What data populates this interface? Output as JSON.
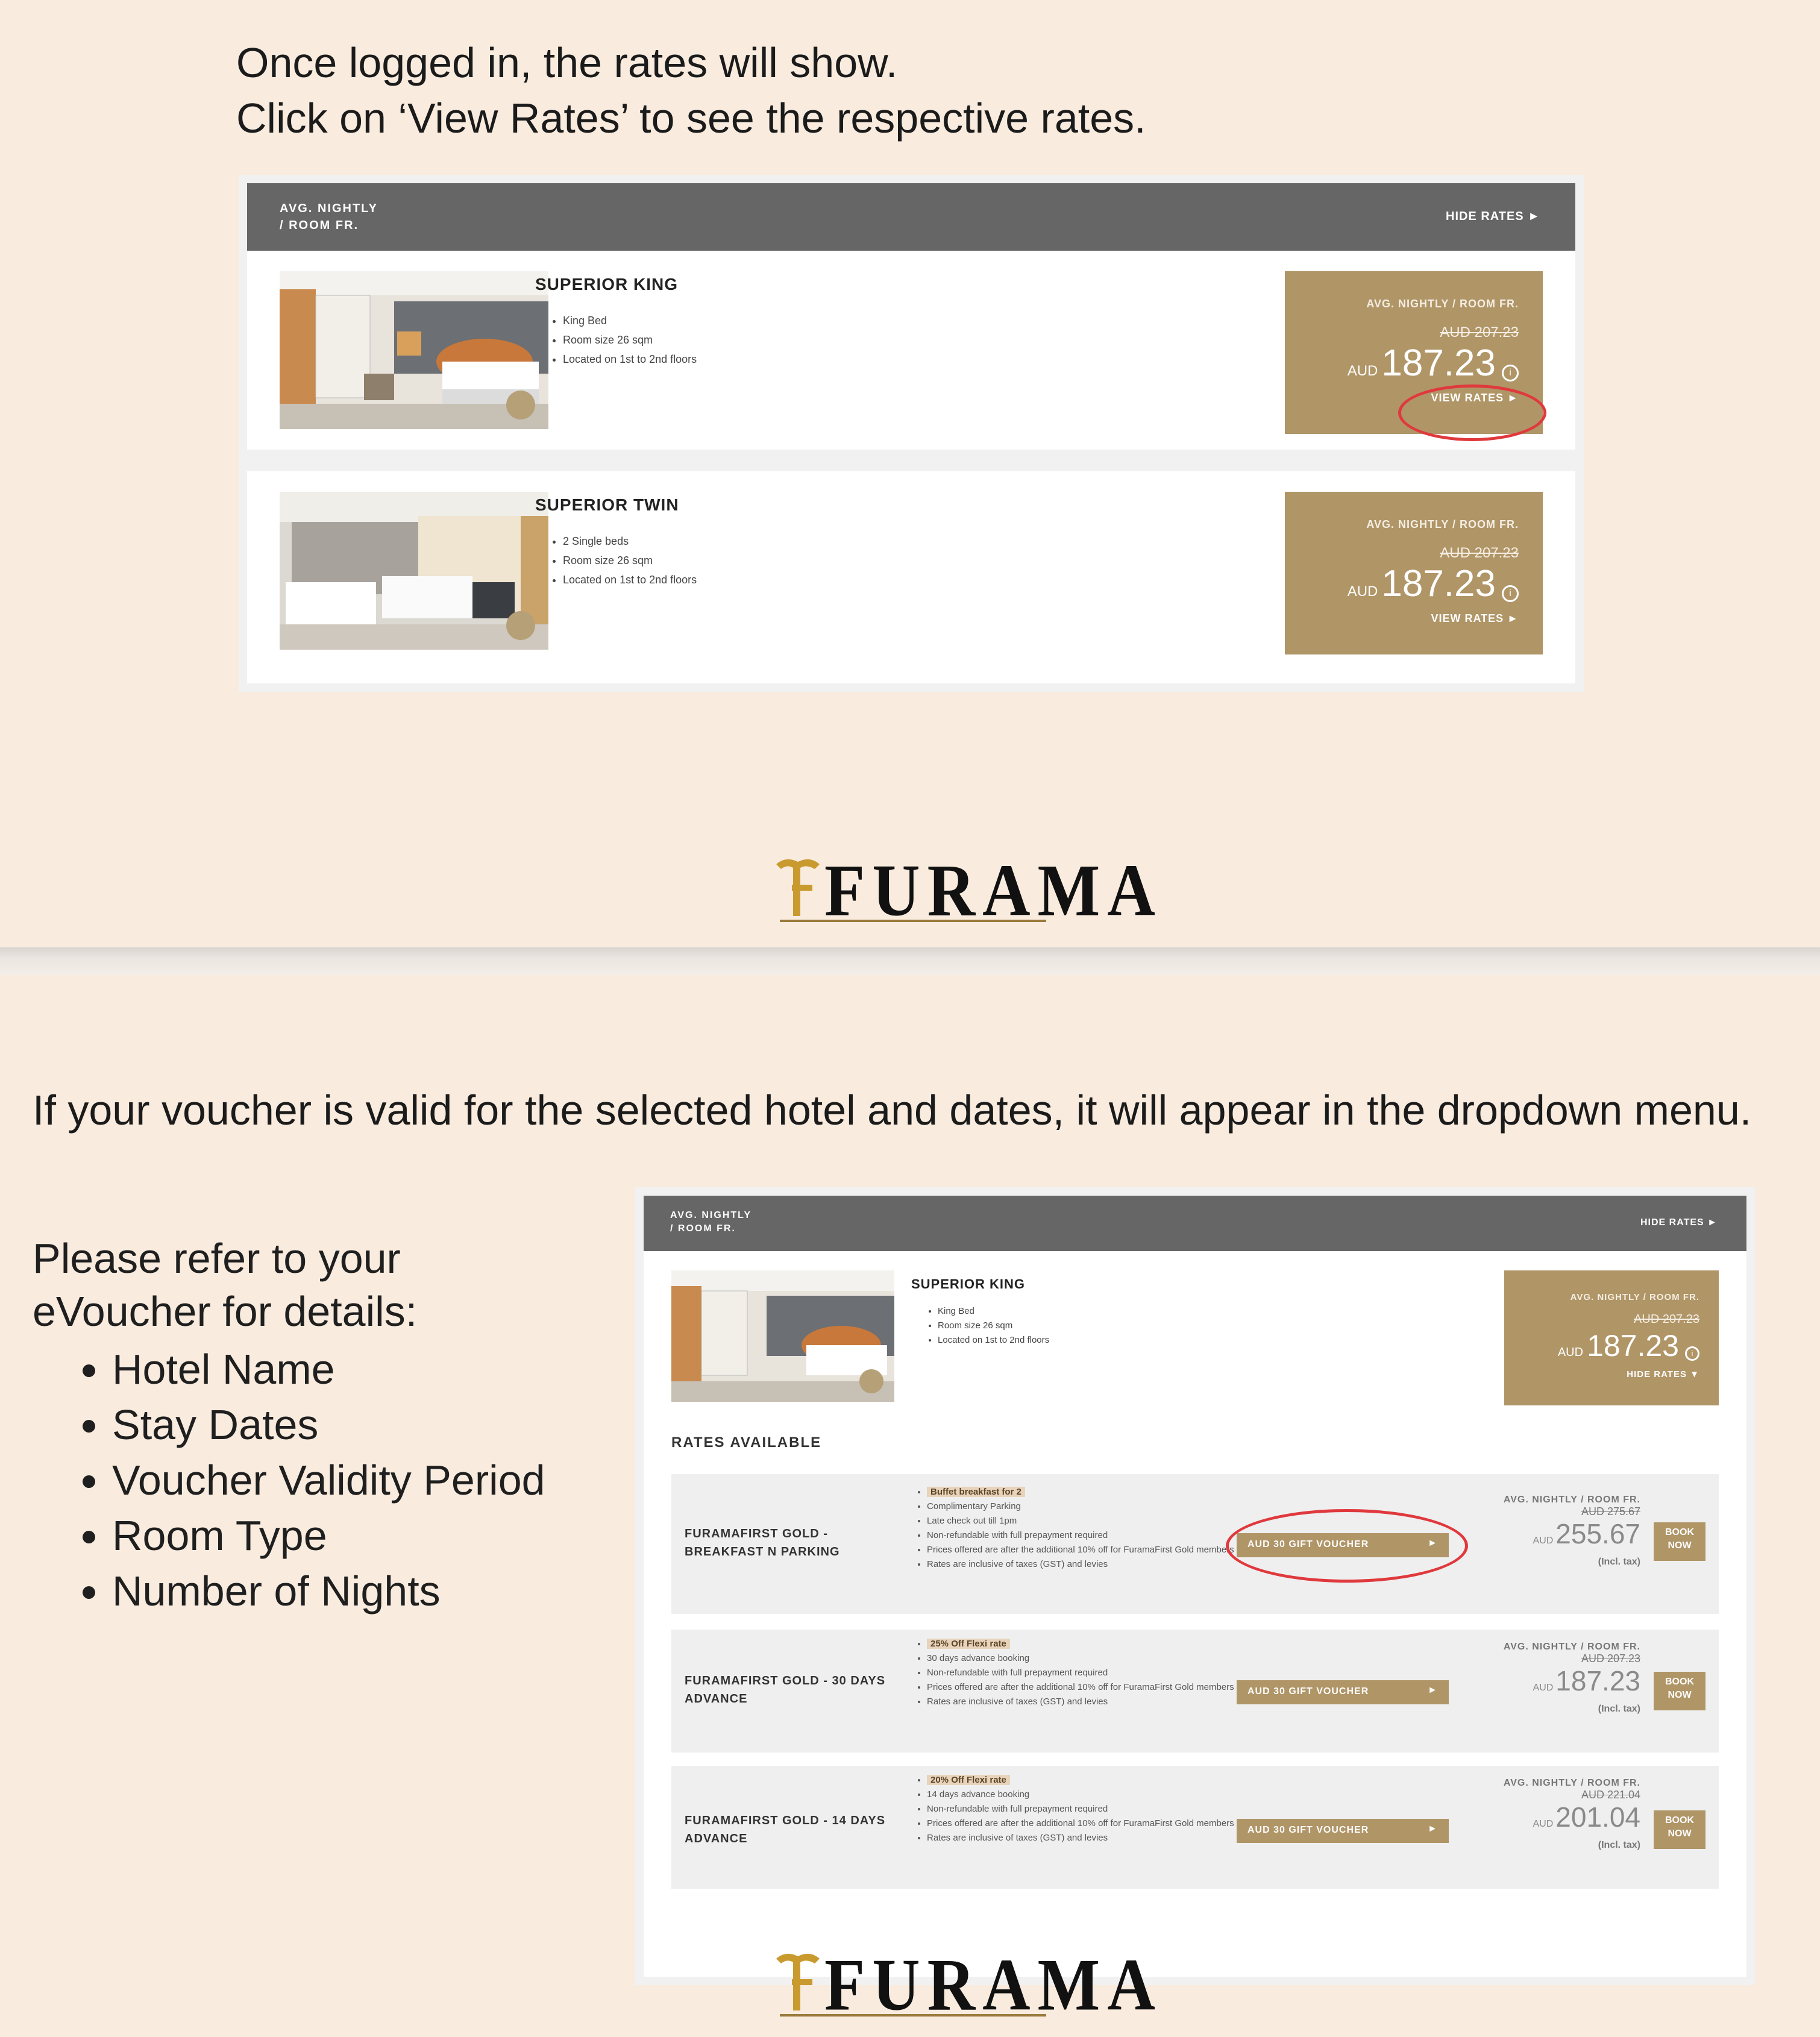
{
  "slide1": {
    "instruction_line1": "Once logged in, the rates will show.",
    "instruction_line2": "Click on ‘View Rates’ to see the respective rates.",
    "header": {
      "left_line1": "AVG. NIGHTLY",
      "left_line2": "/ ROOM FR.",
      "right": "HIDE RATES ►"
    },
    "rooms": [
      {
        "name": "SUPERIOR KING",
        "features": [
          "King Bed",
          "Room size 26 sqm",
          "Located on 1st to 2nd floors"
        ],
        "price_label": "AVG. NIGHTLY / ROOM FR.",
        "old_price": "AUD 207.23",
        "currency": "AUD",
        "price": "187.23",
        "info_icon": "info-icon",
        "link": "VIEW RATES ►"
      },
      {
        "name": "SUPERIOR TWIN",
        "features": [
          "2 Single beds",
          "Room size 26 sqm",
          "Located on 1st to 2nd floors"
        ],
        "price_label": "AVG. NIGHTLY / ROOM FR.",
        "old_price": "AUD 207.23",
        "currency": "AUD",
        "price": "187.23",
        "info_icon": "info-icon",
        "link": "VIEW RATES ►"
      }
    ],
    "logo_text": "FURAMA"
  },
  "slide2": {
    "instruction": "If your voucher is valid for the selected hotel and dates, it will appear in the dropdown menu.",
    "refer_line1": "Please refer to your",
    "refer_line2": "eVoucher for details:",
    "refer_items": [
      "Hotel Name",
      "Stay Dates",
      "Voucher Validity Period",
      "Room Type",
      "Number of Nights"
    ],
    "header": {
      "left_line1": "AVG. NIGHTLY",
      "left_line2": "/ ROOM FR.",
      "right": "HIDE RATES ►"
    },
    "room": {
      "name": "SUPERIOR KING",
      "features": [
        "King Bed",
        "Room size 26 sqm",
        "Located on 1st to 2nd floors"
      ],
      "price_label": "AVG. NIGHTLY / ROOM FR.",
      "old_price": "AUD 207.23",
      "currency": "AUD",
      "price": "187.23",
      "link": "HIDE RATES ▼"
    },
    "rates_title": "RATES AVAILABLE",
    "rates": [
      {
        "name": "FURAMAFIRST GOLD - BREAKFAST N PARKING",
        "features": [
          "Buffet breakfast for 2",
          "Complimentary Parking",
          "Late check out till 1pm",
          "Non-refundable with full prepayment required",
          "Prices offered are after the additional 10% off for FuramaFirst Gold members",
          "Rates are inclusive of taxes (GST) and levies"
        ],
        "voucher": "AUD 30 GIFT VOUCHER",
        "price_label": "AVG. NIGHTLY / ROOM FR.",
        "old_price": "AUD 275.67",
        "currency": "AUD",
        "price": "255.67",
        "incl": "(Incl. tax)",
        "book": "BOOK NOW"
      },
      {
        "name": "FURAMAFIRST GOLD - 30 DAYS ADVANCE",
        "features": [
          "25% Off Flexi rate",
          "30 days advance booking",
          "Non-refundable with full prepayment required",
          "Prices offered are after the additional 10% off for FuramaFirst Gold members",
          "Rates are inclusive of taxes (GST) and levies"
        ],
        "voucher": "AUD 30 GIFT VOUCHER",
        "price_label": "AVG. NIGHTLY / ROOM FR.",
        "old_price": "AUD 207.23",
        "currency": "AUD",
        "price": "187.23",
        "incl": "(Incl. tax)",
        "book": "BOOK NOW"
      },
      {
        "name": "FURAMAFIRST GOLD - 14 DAYS ADVANCE",
        "features": [
          "20% Off Flexi rate",
          "14 days advance booking",
          "Non-refundable with full prepayment required",
          "Prices offered are after the additional 10% off for FuramaFirst Gold members",
          "Rates are inclusive of taxes (GST) and levies"
        ],
        "voucher": "AUD 30 GIFT VOUCHER",
        "price_label": "AVG. NIGHTLY / ROOM FR.",
        "old_price": "AUD 221.04",
        "currency": "AUD",
        "price": "201.04",
        "incl": "(Incl. tax)",
        "book": "BOOK NOW"
      }
    ],
    "logo_text": "FURAMA"
  },
  "colors": {
    "page_bg": "#f9ecdf",
    "gold": "#b09567",
    "header_gray": "#666666",
    "highlight_ring": "#e0393d"
  }
}
